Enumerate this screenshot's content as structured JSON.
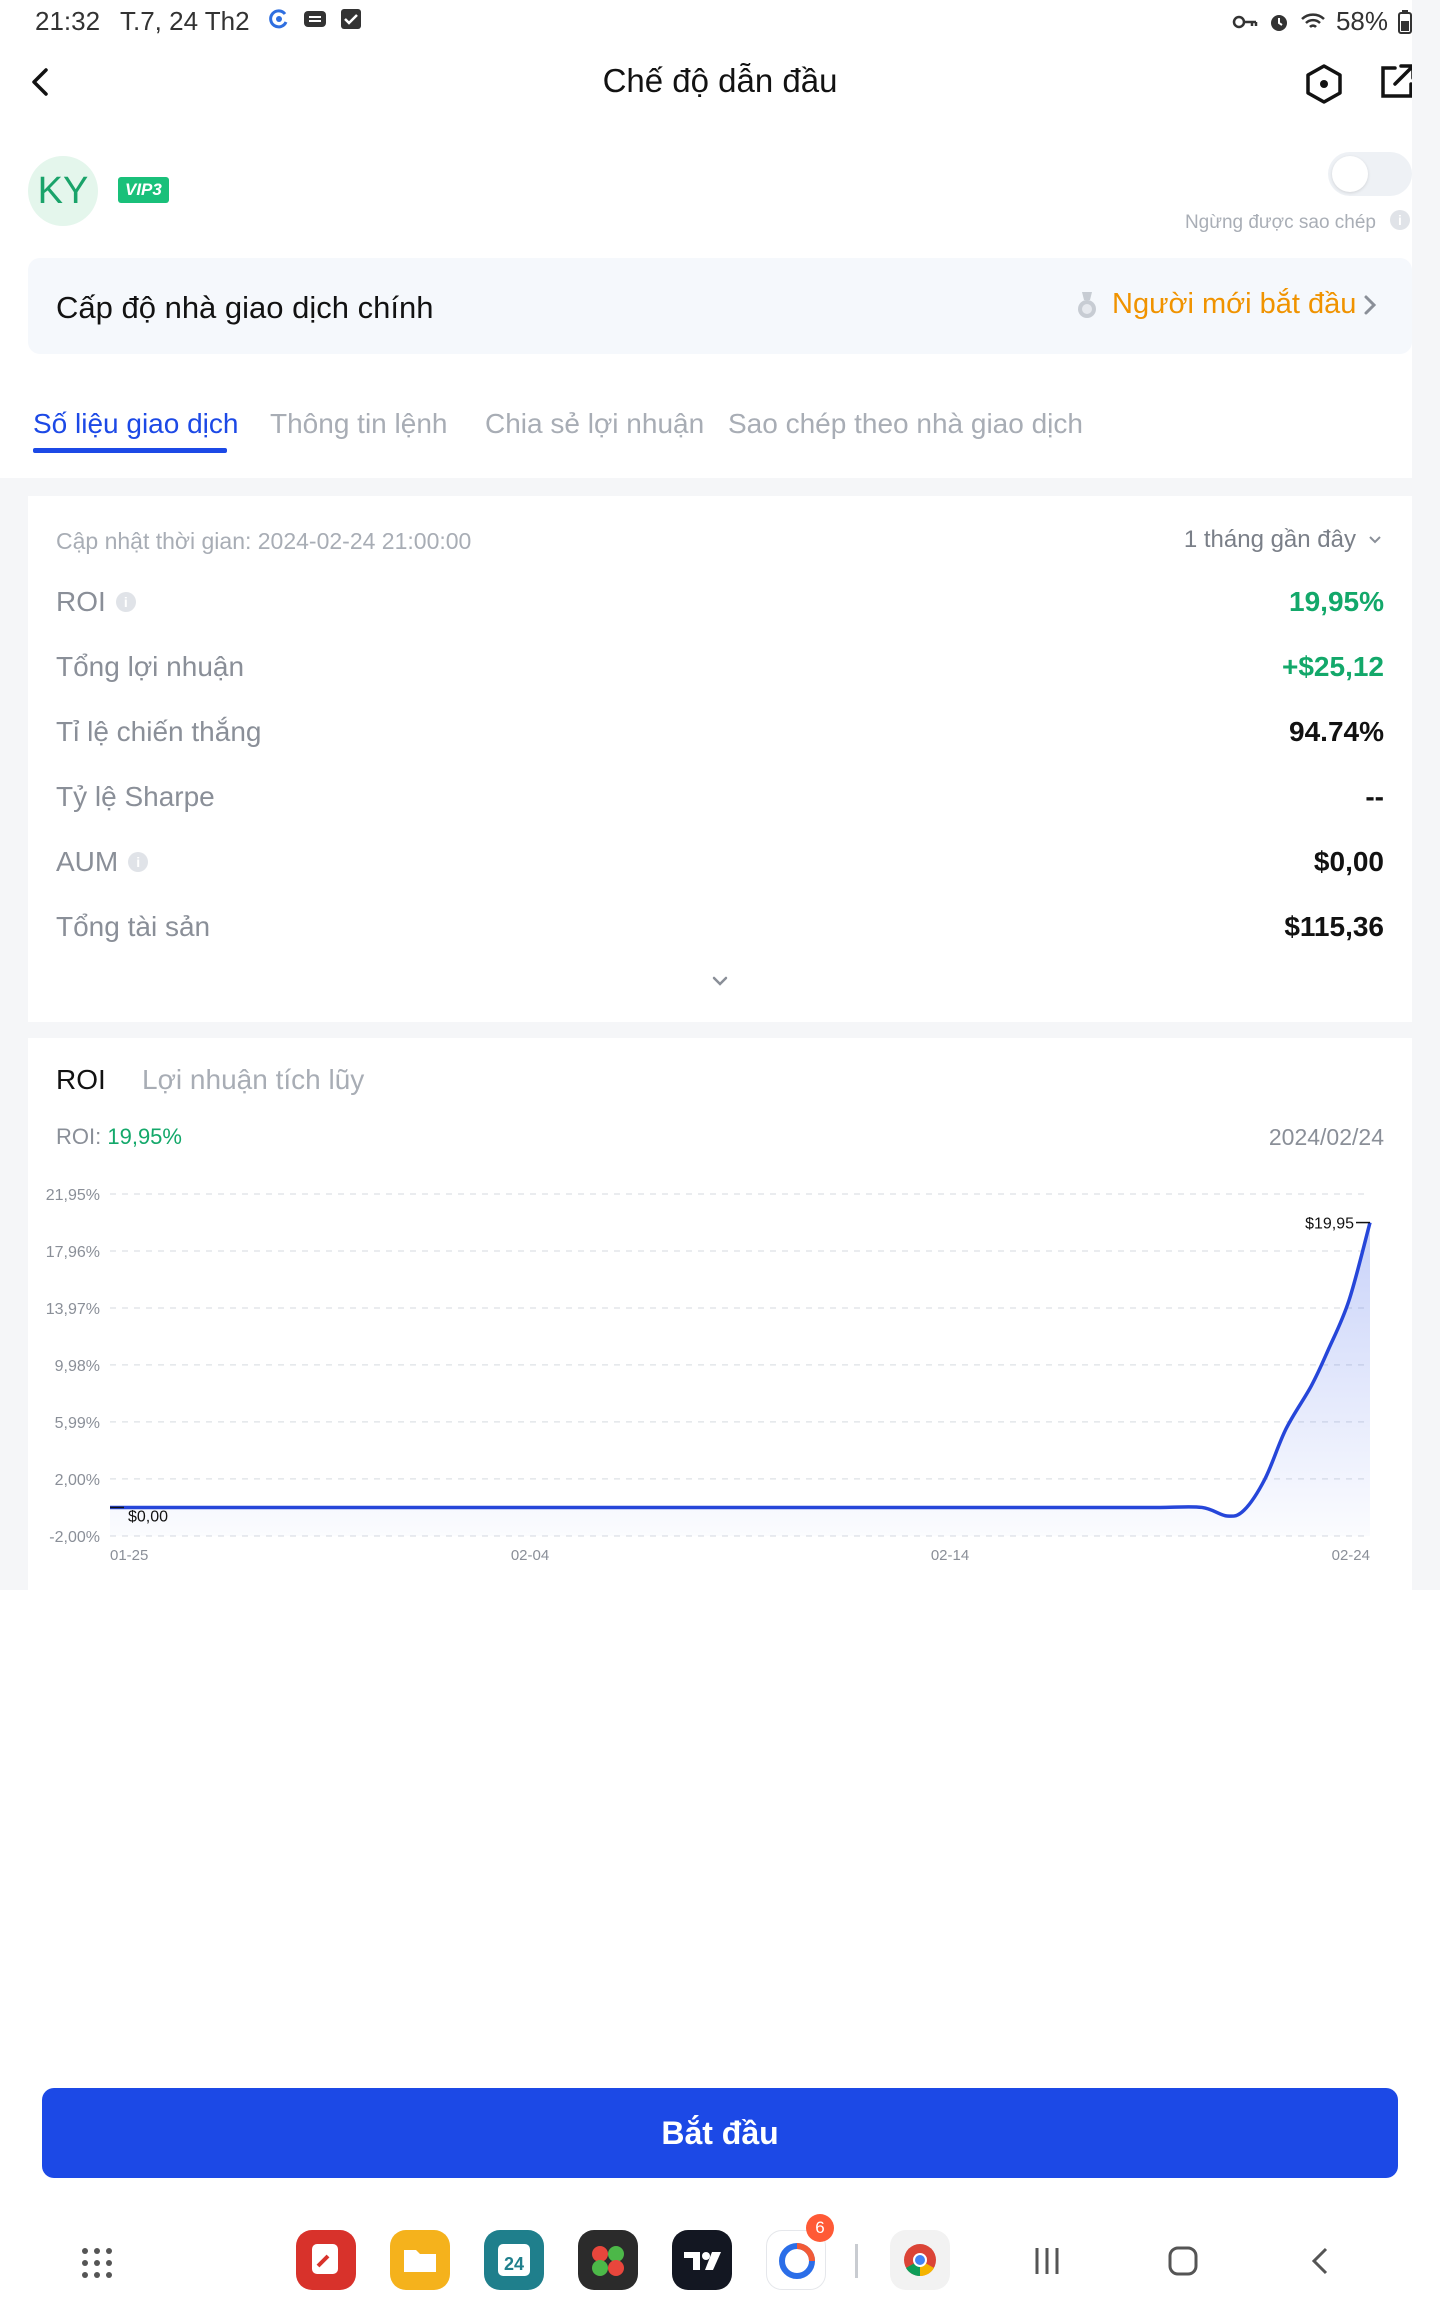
{
  "status_bar": {
    "time": "21:32",
    "date": "T.7, 24 Th2",
    "battery": "58%"
  },
  "header": {
    "title": "Chế độ dẫn đầu"
  },
  "profile": {
    "avatar_text": "KY",
    "vip_badge": "VIP3",
    "copy_toggle_label": "Ngừng được sao chép",
    "copy_toggle_on": false
  },
  "level": {
    "label": "Cấp độ nhà giao dịch chính",
    "value": "Người mới bắt đầu"
  },
  "tabs": [
    {
      "label": "Số liệu giao dịch",
      "active": true
    },
    {
      "label": "Thông tin lệnh",
      "active": false
    },
    {
      "label": "Chia sẻ lợi nhuận",
      "active": false
    },
    {
      "label": "Sao chép theo nhà giao dịch",
      "active": false
    }
  ],
  "stats": {
    "update_time": "Cập nhật thời gian: 2024-02-24 21:00:00",
    "period": "1 tháng gần đây",
    "rows": [
      {
        "label": "ROI",
        "value": "19,95%",
        "info": true,
        "color": "#13a86a"
      },
      {
        "label": "Tổng lợi nhuận",
        "value": "+$25,12",
        "info": false,
        "color": "#13a86a"
      },
      {
        "label": "Tỉ lệ chiến thắng",
        "value": "94.74%",
        "info": false,
        "color": "#121212"
      },
      {
        "label": "Tỷ lệ Sharpe",
        "value": "--",
        "info": false,
        "color": "#121212"
      },
      {
        "label": "AUM",
        "value": "$0,00",
        "info": true,
        "color": "#121212"
      },
      {
        "label": "Tổng tài sản",
        "value": "$115,36",
        "info": false,
        "color": "#121212"
      }
    ]
  },
  "chart_section": {
    "tabs": [
      {
        "label": "ROI",
        "active": true
      },
      {
        "label": "Lợi nhuận tích lũy",
        "active": false
      }
    ],
    "roi_label": "ROI:",
    "roi_value": "19,95%",
    "date": "2024/02/24"
  },
  "chart_data": {
    "type": "area",
    "title": "",
    "xlabel": "",
    "ylabel": "",
    "y_tick_labels": [
      "21,95%",
      "17,96%",
      "13,97%",
      "9,98%",
      "5,99%",
      "2,00%",
      "-2,00%"
    ],
    "y_ticks": [
      21.95,
      17.96,
      13.97,
      9.98,
      5.99,
      2.0,
      -2.0
    ],
    "ylim": [
      -2.0,
      21.95
    ],
    "x_tick_labels": [
      "01-25",
      "02-04",
      "02-14",
      "02-24"
    ],
    "x_ticks": [
      0,
      10,
      20,
      30
    ],
    "xlim": [
      0,
      30
    ],
    "series": [
      {
        "x": [
          0,
          1,
          2,
          3,
          4,
          5,
          6,
          7,
          8,
          9,
          10,
          11,
          12,
          13,
          14,
          15,
          16,
          17,
          18,
          19,
          20,
          21,
          22,
          23,
          24,
          25,
          26,
          26.6,
          27,
          27.5,
          28,
          28.6,
          29,
          29.5,
          30
        ],
        "y": [
          0,
          0,
          0,
          0,
          0,
          0,
          0,
          0,
          0,
          0,
          0,
          0,
          0,
          0,
          0,
          0,
          0,
          0,
          0,
          0,
          0,
          0,
          0,
          0,
          0,
          0,
          0,
          -0.6,
          -0.2,
          2.0,
          5.5,
          8.5,
          11.0,
          14.5,
          19.95
        ]
      }
    ],
    "start_label": "$0,00",
    "end_label": "$19,95",
    "line_color": "#2646d9",
    "grid": true
  },
  "start_button": {
    "label": "Bắt đầu"
  },
  "nav_badge": "6",
  "colors": {
    "accent": "#1c49e6",
    "positive": "#13a86a",
    "level": "#f09300"
  }
}
